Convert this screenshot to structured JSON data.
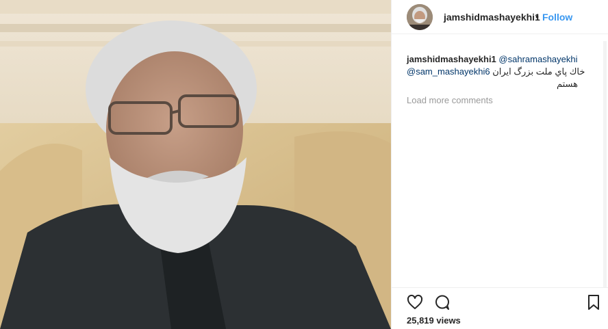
{
  "post": {
    "username": "jamshidmashayekhi1",
    "separator": "•",
    "follow_label": "Follow"
  },
  "caption": {
    "username": "jamshidmashayekhi1",
    "mention1": "@sahramashayekhi",
    "mention2": "@sam_mashayekhi6",
    "text_line1": "خاك پاي ملت بزرگ ايران",
    "text_line2": "هستم"
  },
  "comments": {
    "load_more_label": "Load more comments"
  },
  "stats": {
    "views": "25,819 views"
  },
  "icons": {
    "like": "heart-icon",
    "comment": "comment-icon",
    "save": "bookmark-icon"
  },
  "colors": {
    "accent": "#3897f0",
    "text": "#262626",
    "muted": "#999999"
  }
}
